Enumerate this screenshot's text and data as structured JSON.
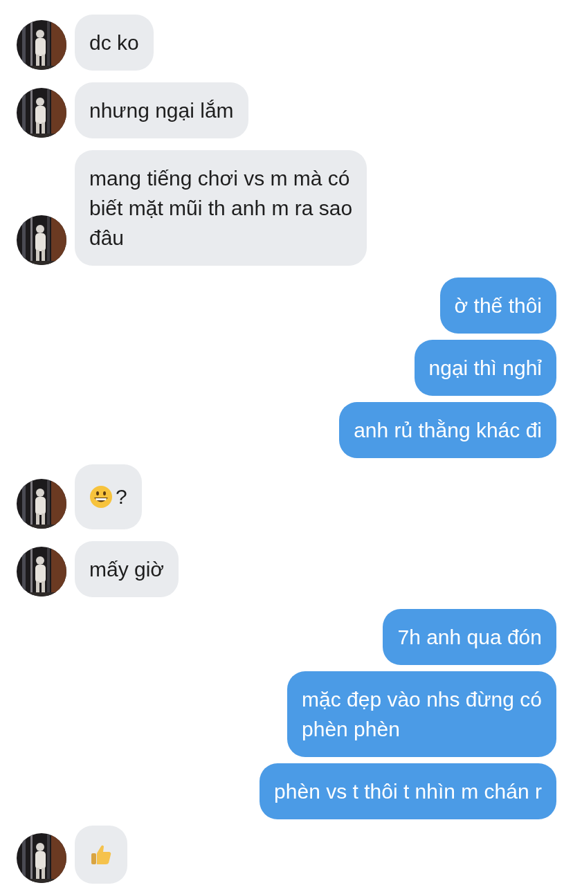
{
  "messages": [
    {
      "sent": false,
      "kind": "text",
      "lines": [
        "dc ko"
      ]
    },
    {
      "sent": false,
      "kind": "text",
      "lines": [
        "nhưng ngại lắm"
      ]
    },
    {
      "sent": false,
      "kind": "text",
      "lines": [
        "mang tiếng chơi vs m mà có",
        "biết mặt mũi th anh m ra sao",
        "đâu"
      ]
    },
    {
      "sent": true,
      "kind": "text",
      "lines": [
        "ờ thế thôi"
      ]
    },
    {
      "sent": true,
      "kind": "text",
      "lines": [
        "ngại thì nghỉ"
      ]
    },
    {
      "sent": true,
      "kind": "text",
      "lines": [
        "anh rủ thằng khác đi"
      ]
    },
    {
      "sent": false,
      "kind": "grin",
      "lines": [
        "?"
      ]
    },
    {
      "sent": false,
      "kind": "text",
      "lines": [
        "mấy giờ"
      ]
    },
    {
      "sent": true,
      "kind": "text",
      "lines": [
        "7h anh qua đón"
      ]
    },
    {
      "sent": true,
      "kind": "text",
      "lines": [
        "mặc đẹp vào nhs đừng có",
        "phèn phèn"
      ]
    },
    {
      "sent": true,
      "kind": "text",
      "lines": [
        "phèn vs t thôi t nhìn m chán r"
      ]
    },
    {
      "sent": false,
      "kind": "thumbs"
    }
  ]
}
